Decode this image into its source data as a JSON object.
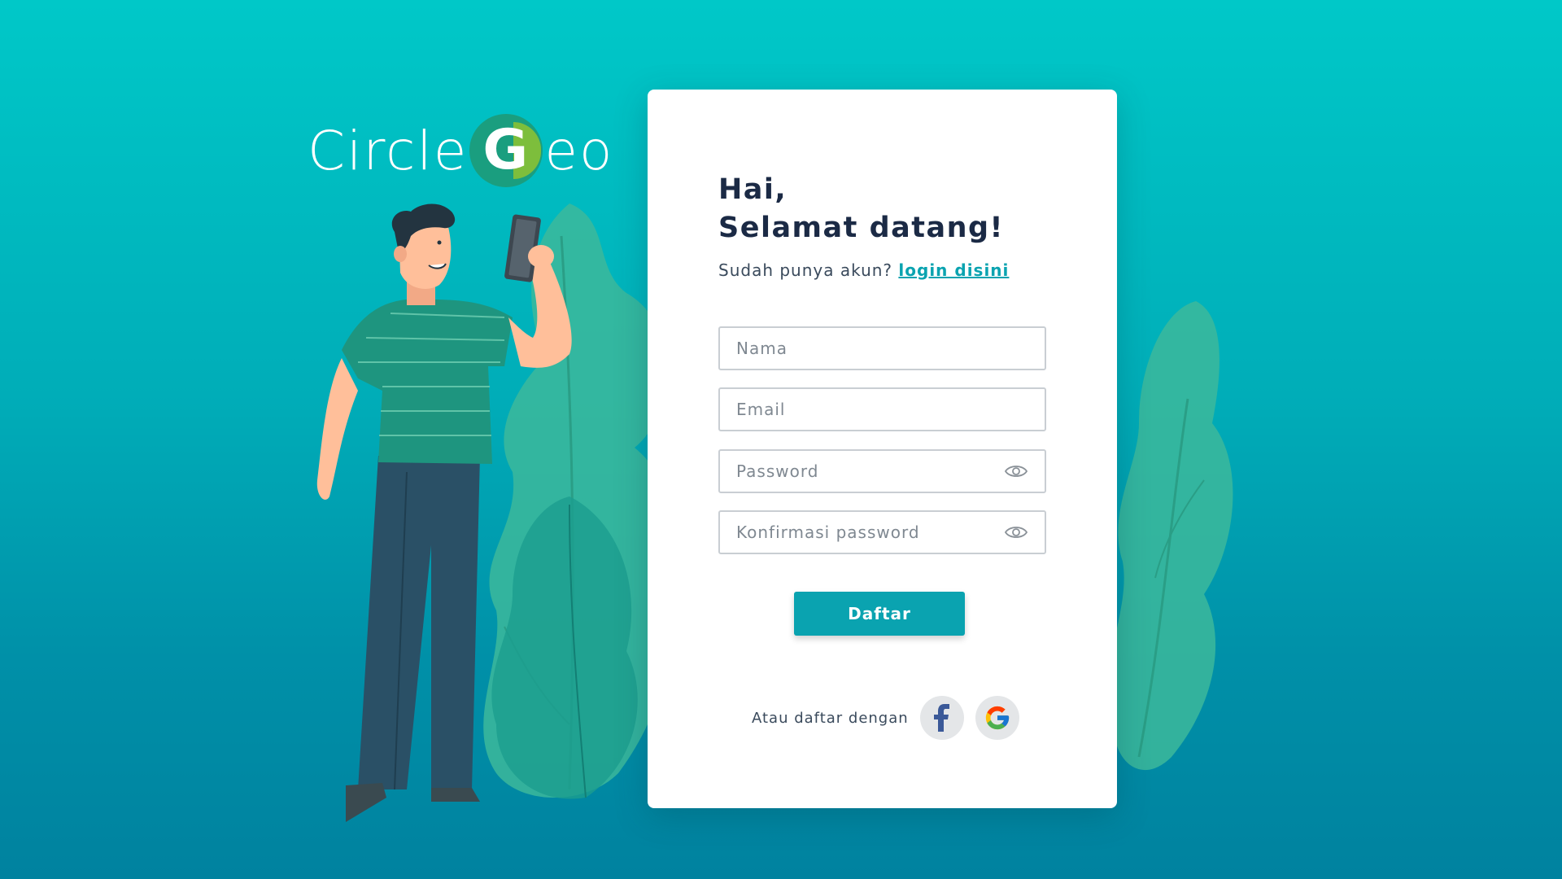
{
  "brand": {
    "name_part1": "Circle",
    "name_letter": "G",
    "name_part2": "eo"
  },
  "card": {
    "greeting_line1": "Hai,",
    "greeting_line2": "Selamat datang!",
    "have_account_text": "Sudah punya akun?",
    "login_link": "login disini"
  },
  "form": {
    "name_placeholder": "Nama",
    "email_placeholder": "Email",
    "password_placeholder": "Password",
    "confirm_password_placeholder": "Konfirmasi password",
    "submit_label": "Daftar"
  },
  "social": {
    "label": "Atau daftar dengan",
    "providers": [
      {
        "icon": "facebook-icon",
        "color": "#3b5998"
      },
      {
        "icon": "google-icon",
        "color": "#4285f4"
      }
    ]
  },
  "colors": {
    "accent": "#0aa3b0",
    "heading": "#1b2a45",
    "background_top": "#00c8c8",
    "background_bottom": "#00829f"
  }
}
